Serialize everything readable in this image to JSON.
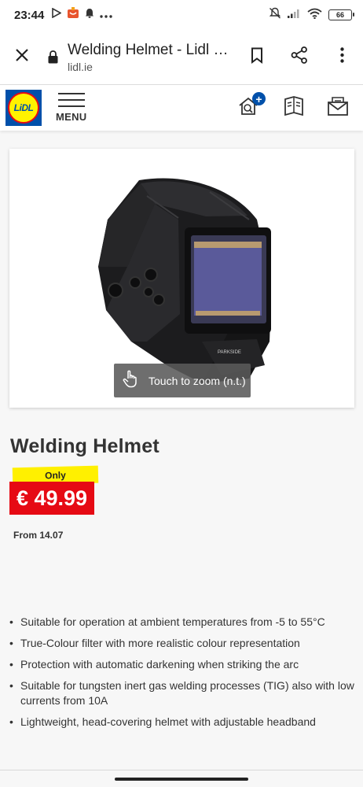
{
  "status_bar": {
    "time": "23:44",
    "battery": "66",
    "left_icons": [
      "play-icon",
      "gift-icon",
      "bell-icon",
      "more-icon"
    ],
    "right_icons": [
      "mute-icon",
      "signal-icon",
      "wifi-icon",
      "battery-icon"
    ]
  },
  "browser": {
    "page_title": "Welding Helmet - Lidl I...",
    "domain": "lidl.ie",
    "icons": [
      "close-icon",
      "lock-icon",
      "bookmark-icon",
      "share-icon",
      "more-vertical-icon"
    ]
  },
  "header": {
    "logo_text": "LiDL",
    "menu_label": "MENU",
    "icons": [
      "add-to-shopping-list-icon",
      "leaflet-icon",
      "newsletter-icon"
    ],
    "badge": "+"
  },
  "product": {
    "zoom_hint": "Touch to zoom (n.t.)",
    "title": "Welding Helmet",
    "price_prefix": "Only",
    "price": "€ 49.99",
    "availability": "From 14.07",
    "features": [
      "Suitable for operation at ambient temperatures from -5 to 55°C",
      "True-Colour filter with more realistic colour representation",
      "Protection with automatic darkening when striking the arc",
      "Suitable for tungsten inert gas welding processes (TIG) also with low currents from 10A",
      "Lightweight, head-covering helmet with adjustable headband"
    ]
  },
  "colors": {
    "lidl_blue": "#0050aa",
    "lidl_yellow": "#fff000",
    "lidl_red": "#e60a14"
  }
}
